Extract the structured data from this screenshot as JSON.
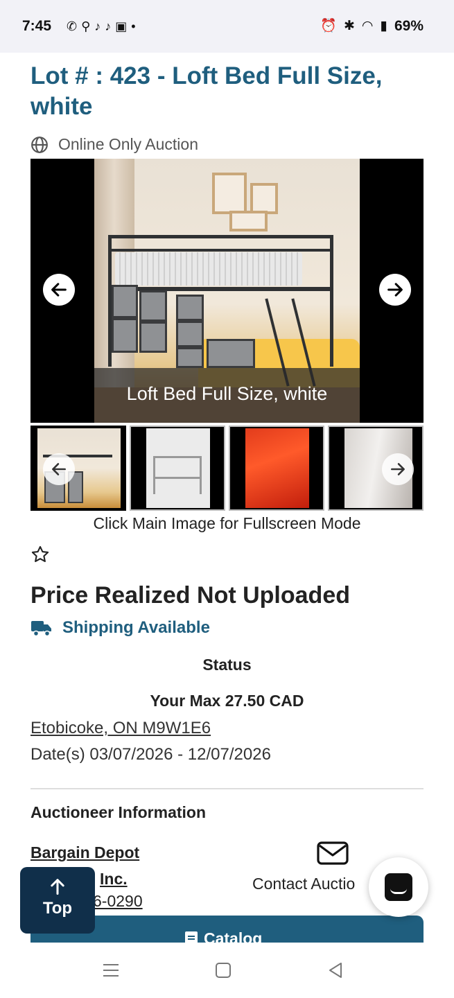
{
  "status_bar": {
    "time": "7:45",
    "battery": "69%",
    "left_icons": [
      "whatsapp-icon",
      "app-icon",
      "tiktok-icon",
      "tiktok-icon",
      "app-icon",
      "dot-icon"
    ],
    "right_icons": [
      "alarm-icon",
      "bluetooth-icon",
      "wifi-icon",
      "signal-icon",
      "battery-icon"
    ]
  },
  "lot": {
    "title": "Lot # : 423 - Loft Bed Full Size, white",
    "auction_type": "Online Only Auction",
    "image_caption": "Loft Bed Full Size, white",
    "fullscreen_hint": "Click Main Image for Fullscreen Mode",
    "price_realized": "Price Realized Not Uploaded",
    "shipping": "Shipping Available",
    "status_label": "Status",
    "max_bid": "Your Max 27.50 CAD",
    "location": "Etobicoke, ON M9W1E6",
    "dates": "Date(s) 03/07/2026 - 12/07/2026"
  },
  "auctioneer": {
    "heading": "Auctioneer Information",
    "name_line1": "Bargain Depot",
    "name_line2": "Inc.",
    "phone_partial": "6-0290",
    "contact_label": "Contact Auctio"
  },
  "buttons": {
    "catalog": "Catalog",
    "top": "Top"
  },
  "colors": {
    "brand_blue": "#1f5e7e",
    "dark_navy": "#102f4a"
  }
}
